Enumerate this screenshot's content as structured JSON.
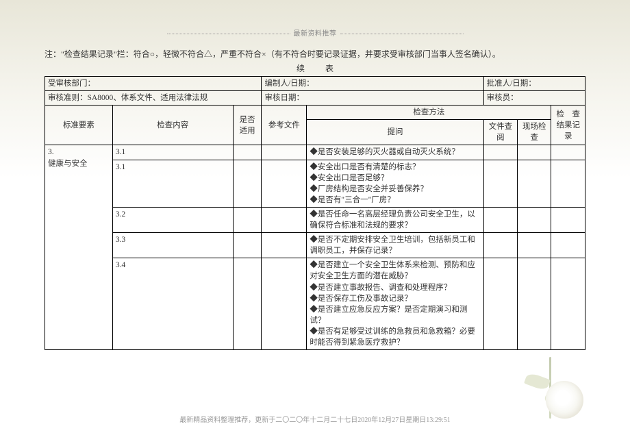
{
  "header_line": "最新资料推荐",
  "note": "注：\"检查结果记录\"栏：符合○，轻微不符合△，严重不符合×（有不符合时要记录证据，并要求受审核部门当事人签名确认）。",
  "continue_label": "续表",
  "info": {
    "dept_label": "受审核部门：",
    "preparer_label": "编制人/日期：",
    "approver_label": "批准人/日期：",
    "criteria_label": "审核准则：SA8000、体系文件、适用法律法规",
    "audit_date_label": "审核日期：",
    "auditor_label": "审核员："
  },
  "headers": {
    "element": "标准要素",
    "content": "检查内容",
    "applicable": "是否适用",
    "ref": "参考文件",
    "method": "检查方法",
    "question": "提问",
    "doc": "文件查阅",
    "site": "现场检查",
    "result": "检　查结果记录"
  },
  "rows": [
    {
      "element_no": "3.",
      "element_name": "健康与安全",
      "content": "3.1",
      "question": "◆是否安装足够的灭火器或自动灭火系统？"
    },
    {
      "content": "3.1",
      "question": "◆安全出口是否有清楚的标志？\n◆安全出口是否足够？\n◆厂房结构是否安全并妥善保养？\n◆是否有\"三合一\"厂房？"
    },
    {
      "content": "3.2",
      "question": "◆是否任命一名高层经理负责公司安全卫生，以确保符合标准和法规的要求？"
    },
    {
      "content": "3.3",
      "question": "◆是否不定期安排安全卫生培训，包括新员工和调职员工，并保存记录？"
    },
    {
      "content": "3.4",
      "question": "◆是否建立一个安全卫生体系来检测、预防和应对安全卫生方面的潜在威胁？\n◆是否建立事故报告、调查和处理程序？\n◆是否保存工伤及事故记录？\n◆是否建立应急反应方案？是否定期演习和测试？\n◆是否有足够受过训练的急救员和急救箱？必要时能否得到紧急医疗救护？"
    }
  ],
  "footer": "最新精品资料整理推荐，更新于二〇二〇年十二月二十七日2020年12月27日星期日13:29:51"
}
